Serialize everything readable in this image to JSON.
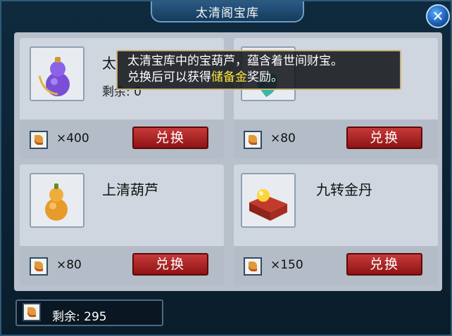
{
  "window": {
    "title": "太清阁宝库"
  },
  "cards": [
    {
      "name": "太",
      "remaining": "剩余: 0",
      "cost": "×400",
      "button": "兑换",
      "icon": "purple-gourd-icon"
    },
    {
      "name": "",
      "remaining": "",
      "cost": "×80",
      "button": "兑换",
      "icon": "jade-pendant-icon"
    },
    {
      "name": "上清葫芦",
      "remaining": "",
      "cost": "×80",
      "button": "兑换",
      "icon": "golden-gourd-icon"
    },
    {
      "name": "九转金丹",
      "remaining": "",
      "cost": "×150",
      "button": "兑换",
      "icon": "golden-pill-box-icon"
    }
  ],
  "tooltip": {
    "line1": "太清宝库中的宝葫芦，蕴含着世间财宝。",
    "line2_pre": "兑换后可以获得",
    "line2_highlight": "储备金",
    "line2_post": "奖励。"
  },
  "footer": {
    "remaining": "剩余: 295",
    "icon": "token-icon"
  },
  "colors": {
    "button": "#a82020",
    "highlight": "#ffe53d",
    "panel": "#b8c0cc"
  }
}
